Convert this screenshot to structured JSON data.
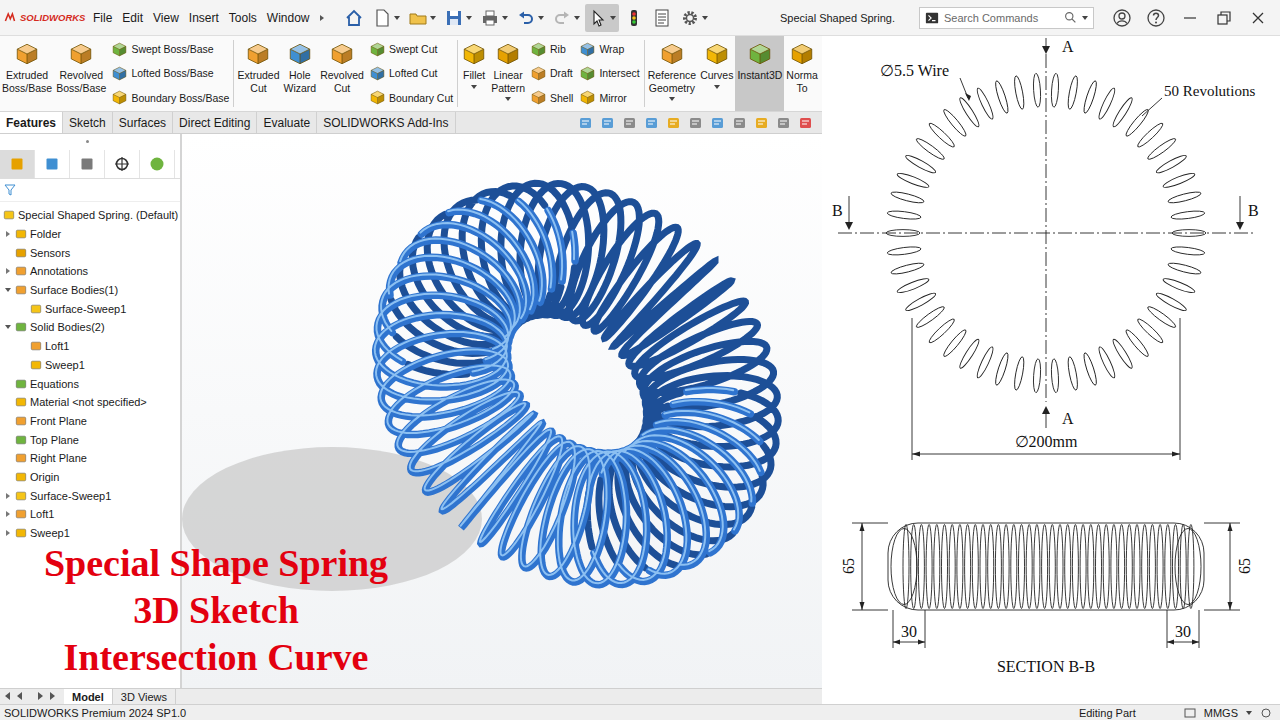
{
  "window": {
    "app": "SOLIDWORKS",
    "title": "Special Shaped Spring."
  },
  "menu": [
    "File",
    "Edit",
    "View",
    "Insert",
    "Tools",
    "Window"
  ],
  "quick_access": [
    {
      "selected": false,
      "dropdown": false
    },
    {
      "selected": false,
      "dropdown": true
    },
    {
      "selected": false,
      "dropdown": true
    },
    {
      "selected": false,
      "dropdown": true
    },
    {
      "selected": false,
      "dropdown": true
    },
    {
      "selected": false,
      "dropdown": true
    },
    {
      "selected": false,
      "dropdown": true
    },
    {
      "selected": true,
      "dropdown": true
    },
    {
      "selected": false,
      "dropdown": false
    },
    {
      "selected": false,
      "dropdown": false
    },
    {
      "selected": false,
      "dropdown": true
    }
  ],
  "search": {
    "placeholder": "Search Commands"
  },
  "ribbon": [
    {
      "kind": "large",
      "lines": [
        "Extruded",
        "Boss/Base"
      ],
      "selected": false,
      "dropdown": false
    },
    {
      "kind": "large",
      "lines": [
        "Revolved",
        "Boss/Base"
      ],
      "selected": false,
      "dropdown": false
    },
    {
      "kind": "stack",
      "items": [
        {
          "label": "Swept Boss/Base",
          "selected": false
        },
        {
          "label": "Lofted Boss/Base",
          "selected": false
        },
        {
          "label": "Boundary Boss/Base",
          "selected": false
        }
      ]
    },
    {
      "kind": "separator"
    },
    {
      "kind": "large",
      "lines": [
        "Extruded",
        "Cut"
      ],
      "selected": false,
      "dropdown": false
    },
    {
      "kind": "large",
      "lines": [
        "Hole",
        "Wizard"
      ],
      "selected": false,
      "dropdown": false
    },
    {
      "kind": "large",
      "lines": [
        "Revolved",
        "Cut"
      ],
      "selected": false,
      "dropdown": false
    },
    {
      "kind": "stack",
      "items": [
        {
          "label": "Swept Cut",
          "selected": false
        },
        {
          "label": "Lofted Cut",
          "selected": false
        },
        {
          "label": "Boundary Cut",
          "selected": false
        }
      ]
    },
    {
      "kind": "separator"
    },
    {
      "kind": "large",
      "lines": [
        "Fillet"
      ],
      "selected": false,
      "dropdown": true
    },
    {
      "kind": "large",
      "lines": [
        "Linear",
        "Pattern"
      ],
      "selected": false,
      "dropdown": true
    },
    {
      "kind": "stack",
      "items": [
        {
          "label": "Rib",
          "selected": false
        },
        {
          "label": "Draft",
          "selected": false
        },
        {
          "label": "Shell",
          "selected": false
        }
      ]
    },
    {
      "kind": "stack",
      "items": [
        {
          "label": "Wrap",
          "selected": false
        },
        {
          "label": "Intersect",
          "selected": false
        },
        {
          "label": "Mirror",
          "selected": false
        }
      ]
    },
    {
      "kind": "separator"
    },
    {
      "kind": "large",
      "lines": [
        "Reference",
        "Geometry"
      ],
      "selected": false,
      "dropdown": true
    },
    {
      "kind": "large",
      "lines": [
        "Curves"
      ],
      "selected": false,
      "dropdown": true
    },
    {
      "kind": "large",
      "lines": [
        "Instant3D"
      ],
      "selected": true,
      "dropdown": false
    },
    {
      "kind": "large",
      "lines": [
        "Norma",
        "To"
      ],
      "selected": false,
      "dropdown": false
    }
  ],
  "command_tabs": [
    {
      "label": "Features",
      "selected": true
    },
    {
      "label": "Sketch",
      "selected": false
    },
    {
      "label": "Surfaces",
      "selected": false
    },
    {
      "label": "Direct Editing",
      "selected": false
    },
    {
      "label": "Evaluate",
      "selected": false
    },
    {
      "label": "SOLIDWORKS Add-Ins",
      "selected": false
    }
  ],
  "panel_tabs": [
    {
      "selected": true
    },
    {
      "selected": false
    },
    {
      "selected": false
    },
    {
      "selected": false
    },
    {
      "selected": false
    }
  ],
  "tree": [
    {
      "label": "Special Shaped Spring. (Default)",
      "level": 0,
      "expander": "none"
    },
    {
      "label": "Folder",
      "level": 1,
      "expander": "collapsed"
    },
    {
      "label": "Sensors",
      "level": 1,
      "expander": "none"
    },
    {
      "label": "Annotations",
      "level": 1,
      "expander": "collapsed"
    },
    {
      "label": "Surface Bodies(1)",
      "level": 1,
      "expander": "expanded"
    },
    {
      "label": "Surface-Sweep1",
      "level": 2,
      "expander": "none"
    },
    {
      "label": "Solid Bodies(2)",
      "level": 1,
      "expander": "expanded"
    },
    {
      "label": "Loft1",
      "level": 2,
      "expander": "none"
    },
    {
      "label": "Sweep1",
      "level": 2,
      "expander": "none"
    },
    {
      "label": "Equations",
      "level": 1,
      "expander": "none"
    },
    {
      "label": "Material <not specified>",
      "level": 1,
      "expander": "none"
    },
    {
      "label": "Front Plane",
      "level": 1,
      "expander": "none"
    },
    {
      "label": "Top Plane",
      "level": 1,
      "expander": "none"
    },
    {
      "label": "Right Plane",
      "level": 1,
      "expander": "none"
    },
    {
      "label": "Origin",
      "level": 1,
      "expander": "none"
    },
    {
      "label": "Surface-Sweep1",
      "level": 1,
      "expander": "collapsed"
    },
    {
      "label": "Loft1",
      "level": 1,
      "expander": "collapsed"
    },
    {
      "label": "Sweep1",
      "level": 1,
      "expander": "collapsed"
    }
  ],
  "overlay_title": [
    "Special Shape Spring",
    "3D Sketch",
    "Intersection Curve"
  ],
  "model_tabs": [
    {
      "label": "Model",
      "selected": true
    },
    {
      "label": "3D Views",
      "selected": false
    }
  ],
  "drawing": {
    "cut_a": {
      "top": "A",
      "bottom": "A"
    },
    "cut_b": {
      "left": "B",
      "right": "B"
    },
    "wire": "∅5.5 Wire",
    "revolutions": "50 Revolutions",
    "diameter": "∅200mm",
    "height_dims": [
      "65",
      "65"
    ],
    "end_dims": [
      "30",
      "30"
    ],
    "section_title": "SECTION B-B"
  },
  "status_bar": {
    "product": "SOLIDWORKS Premium 2024 SP1.0",
    "mode": "Editing Part",
    "units": "MMGS"
  }
}
